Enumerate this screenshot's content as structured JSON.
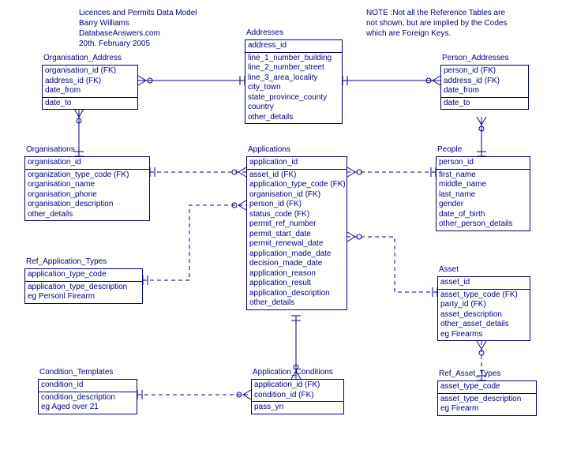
{
  "header": {
    "line1": "Licences and Permits Data Model",
    "line2": "Barry Williams",
    "line3": "DatabaseAnswers.com",
    "line4": "20th. February 2005"
  },
  "note": {
    "line1": "NOTE :Not all the Reference Tables are",
    "line2": "not shown, but are implied by the Codes",
    "line3": "which are Foreign Keys."
  },
  "entities": {
    "organisation_address": {
      "title": "Organisation_Address",
      "pk": [
        "organisation_id (FK)",
        "address_id (FK)",
        "date_from"
      ],
      "attrs": [
        "date_to"
      ]
    },
    "addresses": {
      "title": "Addresses",
      "pk": [
        "address_id"
      ],
      "attrs": [
        "line_1_number_building",
        "line_2_number_street",
        "line_3_area_locality",
        "city_town",
        "state_province_county",
        "country",
        "other_details"
      ]
    },
    "person_addresses": {
      "title": "Person_Addresses",
      "pk": [
        "person_id (FK)",
        "address_id (FK)",
        "date_from"
      ],
      "attrs": [
        "date_to"
      ]
    },
    "organisations": {
      "title": "Organisations",
      "pk": [
        "organisation_id"
      ],
      "attrs": [
        "organization_type_code (FK)",
        "organisation_name",
        "organisation_phone",
        "organisation_description",
        "other_details"
      ]
    },
    "applications": {
      "title": "Applications",
      "pk": [
        "application_id"
      ],
      "attrs": [
        "asset_id (FK)",
        "application_type_code (FK)",
        "organisation_id (FK)",
        "person_id (FK)",
        "status_code (FK)",
        "permit_ref_number",
        "permit_start_date",
        "permit_renewal_date",
        "application_made_date",
        "decision_made_date",
        "application_reason",
        "application_result",
        "application_description",
        "other_details"
      ]
    },
    "people": {
      "title": "People",
      "pk": [
        "person_id"
      ],
      "attrs": [
        "first_name",
        "middle_name",
        "last_name",
        "gender",
        "date_of_birth",
        "other_person_details"
      ]
    },
    "ref_application_types": {
      "title": "Ref_Application_Types",
      "pk": [
        "application_type_code"
      ],
      "attrs": [
        "application_type_description",
        "eg Personl Firearm"
      ]
    },
    "asset": {
      "title": "Asset",
      "pk": [
        "asset_id"
      ],
      "attrs": [
        "asset_type_code (FK)",
        "party_id (FK)",
        "asset_description",
        "other_asset_details",
        "eg Firearms"
      ]
    },
    "condition_templates": {
      "title": "Condition_Templates",
      "pk": [
        "condition_id"
      ],
      "attrs": [
        "condition_description",
        "eg Aged over 21"
      ]
    },
    "application_conditions": {
      "title": "Application_Conditions",
      "pk": [
        "application_id (FK)",
        "condition_id (FK)"
      ],
      "attrs": [
        "pass_yn"
      ]
    },
    "ref_asset_types": {
      "title": "Ref_Asset_Types",
      "pk": [
        "asset_type_code"
      ],
      "attrs": [
        "asset_type_description",
        "eg Firearm"
      ]
    }
  }
}
